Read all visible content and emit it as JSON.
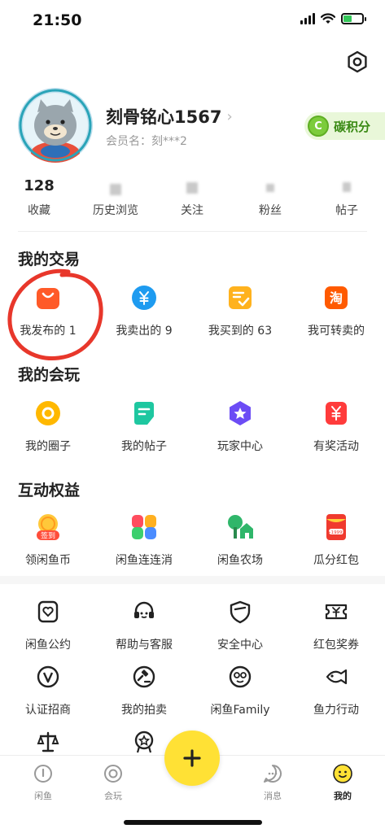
{
  "status_bar": {
    "time": "21:50"
  },
  "profile": {
    "name": "刻骨铭心1567",
    "member_id": "会员名：刻***2",
    "carbon_badge": {
      "icon_letter": "C",
      "label": "碳积分"
    }
  },
  "stats": [
    {
      "value": "128",
      "label": "收藏"
    },
    {
      "value": "",
      "label": "历史浏览"
    },
    {
      "value": "",
      "label": "关注"
    },
    {
      "value": "",
      "label": "粉丝"
    },
    {
      "value": "",
      "label": "帖子"
    }
  ],
  "trade": {
    "title": "我的交易",
    "items": [
      {
        "label": "我发布的 1",
        "icon": "published-bag-icon",
        "color": "#ff5a28"
      },
      {
        "label": "我卖出的 9",
        "icon": "yuan-sold-icon",
        "color": "#1e9bf0"
      },
      {
        "label": "我买到的 63",
        "icon": "bought-check-icon",
        "color": "#ffb21e"
      },
      {
        "label": "我可转卖的",
        "icon": "taobao-icon",
        "color": "#ff5a00"
      }
    ]
  },
  "play": {
    "title": "我的会玩",
    "items": [
      {
        "label": "我的圈子",
        "icon": "circle-ring-icon",
        "color": "#ffb800"
      },
      {
        "label": "我的帖子",
        "icon": "post-icon",
        "color": "#1ec7a0"
      },
      {
        "label": "玩家中心",
        "icon": "star-badge-icon",
        "color": "#6c4cf5"
      },
      {
        "label": "有奖活动",
        "icon": "prize-yuan-icon",
        "color": "#ff3b3b"
      }
    ]
  },
  "interact": {
    "title": "互动权益",
    "items": [
      {
        "label": "领闲鱼币",
        "icon": "sign-in-coin-icon",
        "badge": "签到"
      },
      {
        "label": "闲鱼连连消",
        "icon": "match-game-icon"
      },
      {
        "label": "闲鱼农场",
        "icon": "farm-tree-icon"
      },
      {
        "label": "瓜分红包",
        "icon": "red-packet-icon",
        "badge": "+19999"
      }
    ]
  },
  "services": {
    "row1": [
      {
        "label": "闲鱼公约",
        "icon": "convention-heart-icon"
      },
      {
        "label": "帮助与客服",
        "icon": "headset-icon"
      },
      {
        "label": "安全中心",
        "icon": "shield-icon"
      },
      {
        "label": "红包奖券",
        "icon": "ticket-yuan-icon"
      }
    ],
    "row2": [
      {
        "label": "认证招商",
        "icon": "verify-v-icon"
      },
      {
        "label": "我的拍卖",
        "icon": "auction-hammer-icon"
      },
      {
        "label": "闲鱼Family",
        "icon": "family-face-icon"
      },
      {
        "label": "鱼力行动",
        "icon": "fish-heart-icon"
      }
    ],
    "row3": [
      {
        "icon": "scale-icon"
      },
      {
        "icon": "medal-icon"
      }
    ]
  },
  "tabbar": {
    "tabs": [
      {
        "label": "闲鱼",
        "icon": "home-fish-icon"
      },
      {
        "label": "会玩",
        "icon": "play-circle-icon"
      },
      {
        "label": "消息",
        "icon": "message-icon"
      },
      {
        "label": "我的",
        "icon": "my-face-icon"
      }
    ],
    "publish_icon": "plus-icon"
  },
  "colors": {
    "brand_yellow": "#ffe135",
    "annotation_red": "#e8372b",
    "carbon_green": "#7ccc3c"
  }
}
